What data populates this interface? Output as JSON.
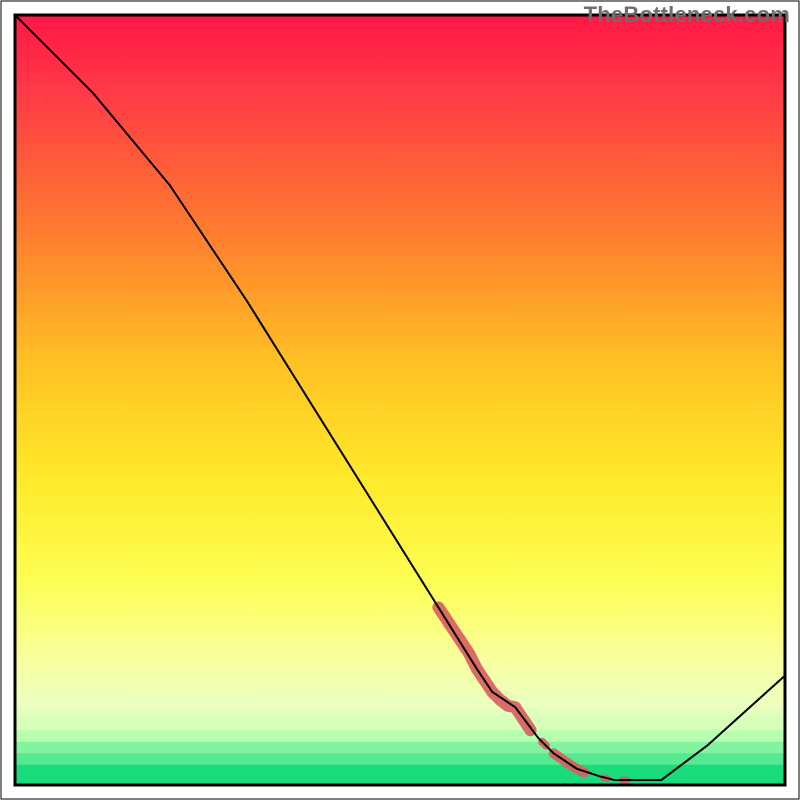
{
  "watermark": "TheBottleneck.com",
  "chart_data": {
    "type": "line",
    "title": "",
    "xlabel": "",
    "ylabel": "",
    "xlim": [
      0,
      100
    ],
    "ylim": [
      0,
      100
    ],
    "background_gradient": {
      "top": "#ff1f4b",
      "mid_upper": "#ff9f2a",
      "mid": "#ffe92a",
      "mid_lower": "#faff7a",
      "bottom_band": "#1fe07f"
    },
    "series": [
      {
        "name": "bottleneck-curve",
        "color": "#000000",
        "stroke_width": 2,
        "x": [
          0,
          5,
          10,
          15,
          20,
          22,
          30,
          40,
          50,
          55,
          60,
          62,
          65,
          68,
          70,
          73,
          76,
          78,
          80,
          82,
          84,
          90,
          100
        ],
        "y": [
          100,
          95,
          90,
          84,
          78,
          75,
          63,
          47,
          31,
          23,
          15,
          12,
          10,
          6,
          4,
          2,
          1,
          0.5,
          0.5,
          0.5,
          0.5,
          5,
          14
        ]
      }
    ],
    "highlight_segments": [
      {
        "name": "cluster-main",
        "color": "#d96060",
        "stroke_width": 12,
        "x": [
          55,
          56,
          57,
          58,
          59,
          60,
          61,
          62,
          63,
          64,
          65,
          66,
          67
        ],
        "y": [
          23,
          21.5,
          20,
          18.5,
          17,
          15,
          13.5,
          12,
          11,
          10.2,
          10,
          8.5,
          7
        ]
      },
      {
        "name": "cluster-dot-1",
        "color": "#d96060",
        "stroke_width": 8,
        "x": [
          68.5,
          69
        ],
        "y": [
          5.5,
          5
        ]
      },
      {
        "name": "cluster-lower",
        "color": "#d96060",
        "stroke_width": 10,
        "x": [
          70,
          71,
          72,
          73,
          74
        ],
        "y": [
          4,
          3.3,
          2.6,
          2,
          1.5
        ]
      },
      {
        "name": "cluster-dot-2",
        "color": "#d96060",
        "stroke_width": 7,
        "x": [
          76.5,
          77
        ],
        "y": [
          0.8,
          0.7
        ]
      },
      {
        "name": "cluster-dot-3",
        "color": "#d96060",
        "stroke_width": 7,
        "x": [
          79,
          79.5
        ],
        "y": [
          0.5,
          0.5
        ]
      }
    ],
    "border": {
      "color": "#000000",
      "width": 3
    }
  }
}
